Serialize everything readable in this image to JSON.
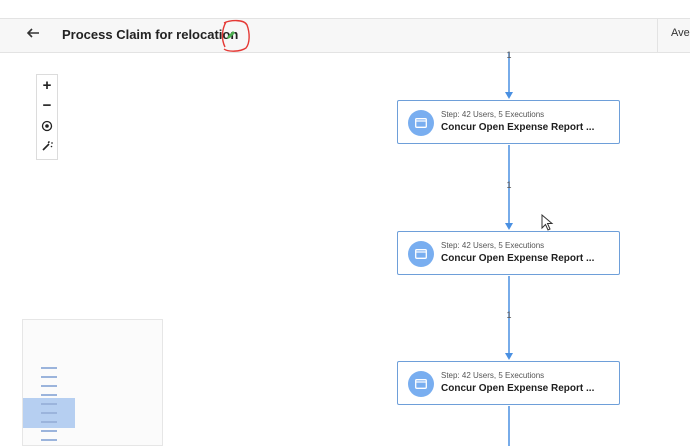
{
  "header": {
    "title": "Process Claim for relocation",
    "right_tab_label": "Aver"
  },
  "icons": {
    "back": "arrow-left-icon",
    "edit": "pencil-icon",
    "zoom_in": "plus-icon",
    "zoom_out": "minus-icon",
    "recenter": "target-icon",
    "auto_layout": "magic-wand-icon",
    "step": "window-icon"
  },
  "colors": {
    "accent": "#4a90e2",
    "node_border": "#6e9fd9",
    "icon_bg": "#79aef0",
    "edit_icon": "#4caf50",
    "annotation": "#e53935"
  },
  "zoom_controls": {
    "zoom_in_label": "+",
    "zoom_out_label": "−"
  },
  "flow": {
    "connectors": [
      {
        "count": "1"
      },
      {
        "count": "1"
      },
      {
        "count": "1"
      }
    ],
    "nodes": [
      {
        "meta": "Step: 42 Users, 5 Executions",
        "name": "Concur Open Expense Report ..."
      },
      {
        "meta": "Step: 42 Users, 5 Executions",
        "name": "Concur Open Expense Report ..."
      },
      {
        "meta": "Step: 42 Users, 5 Executions",
        "name": "Concur Open Expense Report ..."
      }
    ]
  }
}
